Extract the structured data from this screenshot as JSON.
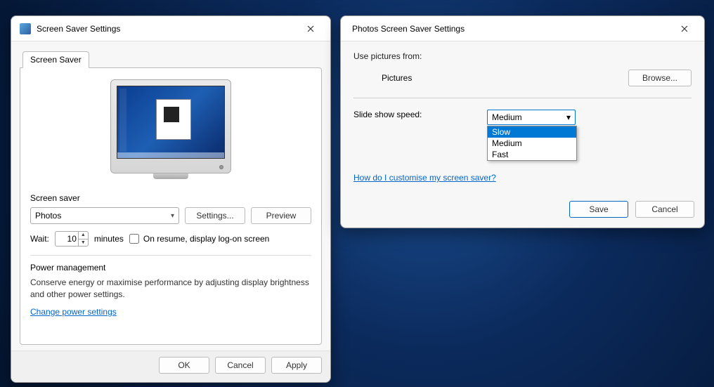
{
  "left": {
    "title": "Screen Saver Settings",
    "tab_label": "Screen Saver",
    "screensaver_label": "Screen saver",
    "screensaver_value": "Photos",
    "settings_btn": "Settings...",
    "preview_btn": "Preview",
    "wait_label": "Wait:",
    "wait_value": "10",
    "wait_unit": "minutes",
    "resume_label": "On resume, display log-on screen",
    "power_heading": "Power management",
    "power_text": "Conserve energy or maximise performance by adjusting display brightness and other power settings.",
    "power_link": "Change power settings",
    "ok": "OK",
    "cancel": "Cancel",
    "apply": "Apply"
  },
  "right": {
    "title": "Photos Screen Saver Settings",
    "use_pictures_label": "Use pictures from:",
    "pictures_value": "Pictures",
    "browse_btn": "Browse...",
    "speed_label": "Slide show speed:",
    "speed_value": "Medium",
    "speed_options": {
      "slow": "Slow",
      "medium": "Medium",
      "fast": "Fast"
    },
    "customize_link": "How do I customise my screen saver?",
    "save": "Save",
    "cancel": "Cancel"
  }
}
